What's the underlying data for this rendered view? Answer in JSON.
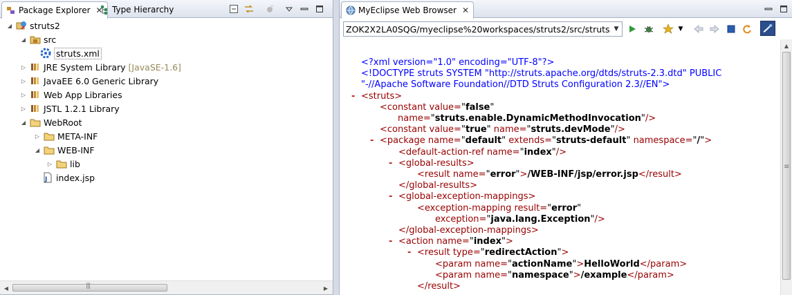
{
  "left_view": {
    "tabs": [
      {
        "label": "Package Explorer",
        "close": "✕"
      },
      {
        "label": "Type Hierarchy"
      }
    ],
    "tree": [
      {
        "label": "struts2",
        "icon": "web-project-icon",
        "expanded": true,
        "depth": 0
      },
      {
        "label": "src",
        "icon": "source-folder-icon",
        "expanded": true,
        "depth": 1
      },
      {
        "label": "struts.xml",
        "icon": "struts-xml-icon",
        "depth": 2,
        "selected": true
      },
      {
        "label": "JRE System Library",
        "decoration": "[JavaSE-1.6]",
        "icon": "library-icon",
        "expanded": false,
        "depth": 1
      },
      {
        "label": "JavaEE 6.0 Generic Library",
        "icon": "library-icon",
        "expanded": false,
        "depth": 1
      },
      {
        "label": "Web App Libraries",
        "icon": "library-icon",
        "expanded": false,
        "depth": 1
      },
      {
        "label": "JSTL 1.2.1 Library",
        "icon": "library-icon",
        "expanded": false,
        "depth": 1
      },
      {
        "label": "WebRoot",
        "icon": "folder-icon",
        "expanded": true,
        "depth": 1
      },
      {
        "label": "META-INF",
        "icon": "folder-icon",
        "expanded": false,
        "depth": 2
      },
      {
        "label": "WEB-INF",
        "icon": "folder-icon",
        "expanded": true,
        "depth": 2
      },
      {
        "label": "lib",
        "icon": "folder-icon",
        "expanded": false,
        "depth": 3
      },
      {
        "label": "index.jsp",
        "icon": "jsp-file-icon",
        "depth": 2
      }
    ]
  },
  "browser": {
    "tab_label": "MyEclipse Web Browser",
    "tab_close": "✕",
    "url": "ZOK2X2LA0SQG/myeclipse%20workspaces/struts2/src/struts.xml",
    "xml": {
      "l1": "<?xml version=\"1.0\" encoding=\"UTF-8\"?>",
      "l2": "<!DOCTYPE struts SYSTEM \"http://struts.apache.org/dtds/struts-2.3.dtd\" PUBLIC",
      "l3": "\"-//Apache Software Foundation//DTD Struts Configuration 2.3//EN\">",
      "struts_open": "<struts>",
      "constant": "<constant",
      "value_attr": "value=",
      "q": "\"",
      "v_false": "false",
      "name_attr": "name=",
      "v_dmi": "struts.enable.DynamicMethodInvocation",
      "selfclose": "/>",
      "v_true": "true",
      "v_devmode": "struts.devMode",
      "package": "<package",
      "v_default": "default",
      "extends_attr": "extends=",
      "v_struts_default": "struts-default",
      "namespace_attr": "namespace=",
      "v_slash": "/",
      "gt": ">",
      "default_action_ref": "<default-action-ref",
      "v_index": "index",
      "global_results_open": "<global-results>",
      "result": "<result",
      "v_error": "error",
      "t_error_jsp": "/WEB-INF/jsp/error.jsp",
      "result_close": "</result>",
      "global_results_close": "</global-results>",
      "gem_open": "<global-exception-mappings>",
      "exception_mapping": "<exception-mapping",
      "result_attr": "result=",
      "exception_attr": "exception=",
      "v_exception": "java.lang.Exception",
      "gem_close": "</global-exception-mappings>",
      "action": "<action",
      "type_attr": "type=",
      "v_redirect": "redirectAction",
      "param": "<param",
      "v_action_name": "actionName",
      "t_helloworld": "HelloWorld",
      "param_close": "</param>",
      "v_namespace": "namespace",
      "t_example": "/example",
      "minus": "-"
    }
  }
}
